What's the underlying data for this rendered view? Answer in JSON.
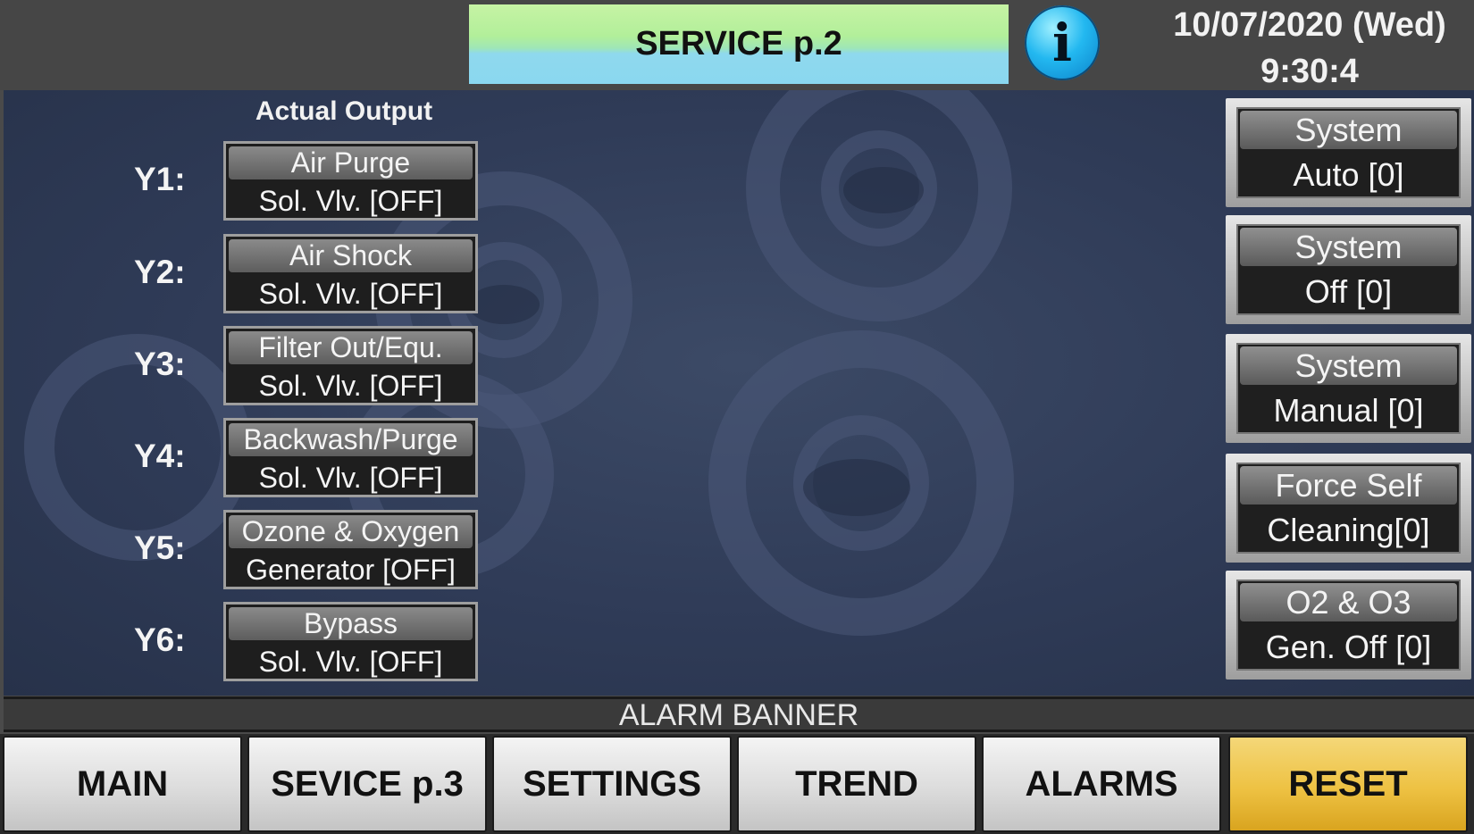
{
  "header": {
    "title": "SERVICE p.2",
    "info_icon": "i",
    "date": "10/07/2020 (Wed)",
    "time": "9:30:4"
  },
  "outputs": {
    "section_title": "Actual Output",
    "items": [
      {
        "label": "Y1:",
        "line1": "Air Purge",
        "line2": "Sol. Vlv. [OFF]"
      },
      {
        "label": "Y2:",
        "line1": "Air Shock",
        "line2": "Sol. Vlv. [OFF]"
      },
      {
        "label": "Y3:",
        "line1": "Filter Out/Equ.",
        "line2": "Sol. Vlv. [OFF]"
      },
      {
        "label": "Y4:",
        "line1": "Backwash/Purge",
        "line2": "Sol. Vlv. [OFF]"
      },
      {
        "label": "Y5:",
        "line1": "Ozone & Oxygen",
        "line2": "Generator [OFF]"
      },
      {
        "label": "Y6:",
        "line1": "Bypass",
        "line2": "Sol. Vlv. [OFF]"
      }
    ]
  },
  "side_buttons": [
    {
      "line1": "System",
      "line2": "Auto [0]"
    },
    {
      "line1": "System",
      "line2": "Off [0]"
    },
    {
      "line1": "System",
      "line2": "Manual [0]"
    },
    {
      "line1": "Force Self",
      "line2": "Cleaning[0]"
    },
    {
      "line1": "O2 & O3",
      "line2": "Gen. Off [0]"
    }
  ],
  "alarm_banner": "ALARM BANNER",
  "nav": {
    "main": "MAIN",
    "service_p3": "SEVICE p.3",
    "settings": "SETTINGS",
    "trend": "TREND",
    "alarms": "ALARMS",
    "reset": "RESET"
  },
  "colors": {
    "panel_bg": "#2f3b57",
    "header_bg": "#464646",
    "reset_button": "#eec243",
    "info_button": "#23b8f0"
  }
}
